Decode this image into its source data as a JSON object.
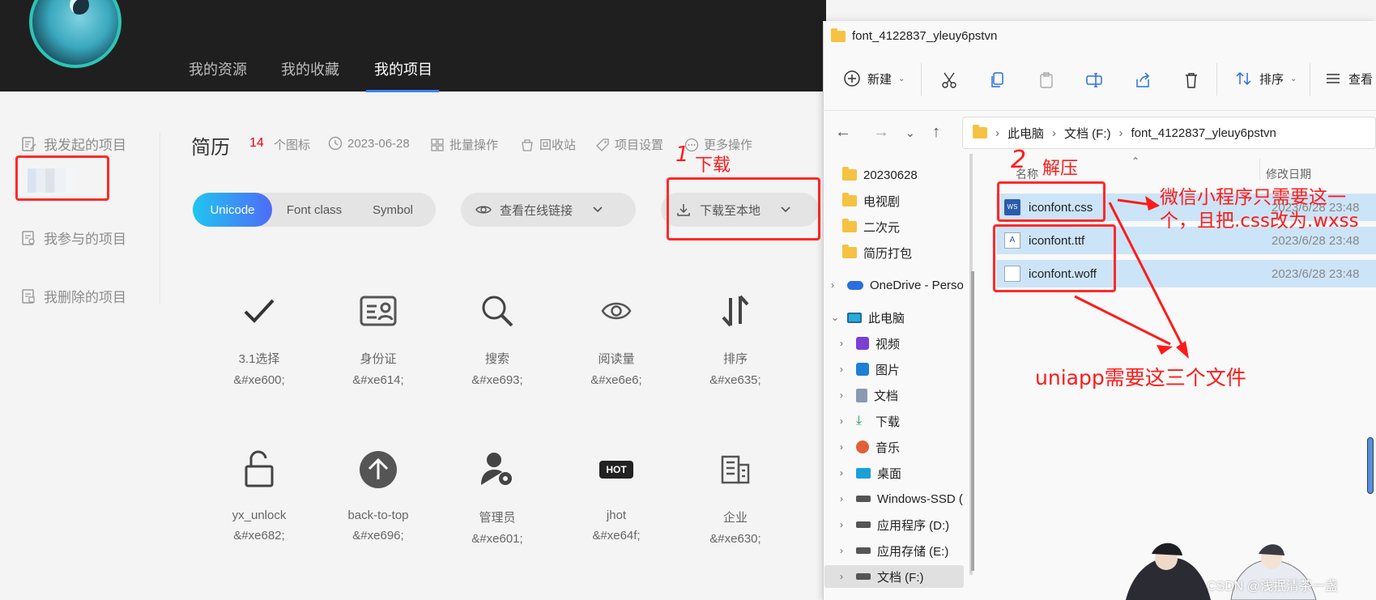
{
  "nav": {
    "items": [
      "我的资源",
      "我的收藏",
      "我的项目"
    ],
    "active_index": 2
  },
  "sidebar": {
    "items": [
      "我发起的项目",
      "我参与的项目",
      "我删除的项目"
    ]
  },
  "project": {
    "title": "简历",
    "count": "14",
    "count_unit": "个图标",
    "date": "2023-06-28",
    "actions": [
      "批量操作",
      "回收站",
      "项目设置",
      "更多操作"
    ]
  },
  "tabs": {
    "items": [
      "Unicode",
      "Font class",
      "Symbol"
    ],
    "active_index": 0
  },
  "buttons": {
    "view_link": "查看在线链接",
    "download": "下载至本地"
  },
  "icons": [
    {
      "name": "3.1选择",
      "code": "&#xe600;",
      "icon": "check-icon"
    },
    {
      "name": "身份证",
      "code": "&#xe614;",
      "icon": "id-card-icon"
    },
    {
      "name": "搜索",
      "code": "&#xe693;",
      "icon": "search-icon"
    },
    {
      "name": "阅读量",
      "code": "&#xe6e6;",
      "icon": "eye-icon"
    },
    {
      "name": "排序",
      "code": "&#xe635;",
      "icon": "sort-icon"
    },
    {
      "name": "yx_unlock",
      "code": "&#xe682;",
      "icon": "unlock-icon"
    },
    {
      "name": "back-to-top",
      "code": "&#xe696;",
      "icon": "back-to-top-icon"
    },
    {
      "name": "管理员",
      "code": "&#xe601;",
      "icon": "admin-icon"
    },
    {
      "name": "jhot",
      "code": "&#xe64f;",
      "icon": "hot-icon"
    },
    {
      "name": "企业",
      "code": "&#xe630;",
      "icon": "building-icon"
    }
  ],
  "icon_hot_text": "HOT",
  "annotations": {
    "download_num": "1",
    "download": "下载",
    "unzip_num": "2",
    "unzip": "解压",
    "wechat_note": "微信小程序只需要这一个，且把.css改为.wxss",
    "uniapp_note": "uniapp需要这三个文件"
  },
  "explorer": {
    "title": "font_4122837_yleuy6pstvn",
    "toolbar": {
      "new": "新建",
      "sort": "排序",
      "view": "查看"
    },
    "breadcrumb": [
      "此电脑",
      "文档 (F:)",
      "font_4122837_yleuy6pstvn"
    ],
    "tree": [
      {
        "label": "20230628",
        "type": "folder"
      },
      {
        "label": "电视剧",
        "type": "folder"
      },
      {
        "label": "二次元",
        "type": "folder"
      },
      {
        "label": "简历打包",
        "type": "folder"
      },
      {
        "label": "OneDrive - Perso",
        "type": "cloud"
      },
      {
        "label": "此电脑",
        "type": "pc"
      },
      {
        "label": "视频",
        "type": "video"
      },
      {
        "label": "图片",
        "type": "picture"
      },
      {
        "label": "文档",
        "type": "doc"
      },
      {
        "label": "下载",
        "type": "download"
      },
      {
        "label": "音乐",
        "type": "music"
      },
      {
        "label": "桌面",
        "type": "desktop"
      },
      {
        "label": "Windows-SSD (",
        "type": "drive"
      },
      {
        "label": "应用程序 (D:)",
        "type": "drive"
      },
      {
        "label": "应用存储 (E:)",
        "type": "drive"
      },
      {
        "label": "文档 (F:)",
        "type": "drive"
      }
    ],
    "columns": {
      "name": "名称",
      "modified": "修改日期"
    },
    "files": [
      {
        "name": "iconfont.css",
        "date": "2023/6/28 23:48",
        "icon": "css-file-icon"
      },
      {
        "name": "iconfont.ttf",
        "date": "2023/6/28 23:48",
        "icon": "font-file-icon"
      },
      {
        "name": "iconfont.woff",
        "date": "2023/6/28 23:48",
        "icon": "file-icon"
      }
    ]
  },
  "watermark": "CSDN @浅抿清茶一盏",
  "colors": {
    "accent": "#3b82f6",
    "annotation": "#ff1a1a",
    "count": "#e60012",
    "selection": "#cce4f7"
  }
}
